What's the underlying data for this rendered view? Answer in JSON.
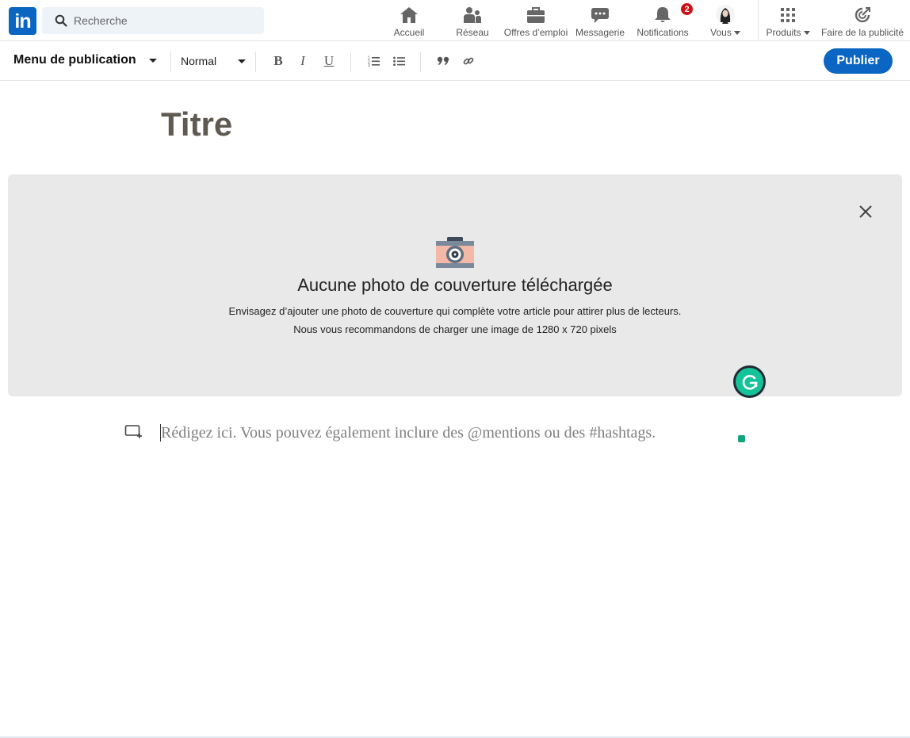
{
  "nav": {
    "logo": "in",
    "search_placeholder": "Recherche",
    "home": "Accueil",
    "network": "Réseau",
    "jobs": "Offres d’emploi",
    "messaging": "Messagerie",
    "notifications": "Notifications",
    "notifications_count": "2",
    "me": "Vous",
    "products": "Produits",
    "advertise": "Faire de la publicité"
  },
  "toolbar": {
    "publication_menu": "Menu de publication",
    "text_style": "Normal",
    "bold": "B",
    "italic": "I",
    "underline": "U",
    "publish": "Publier"
  },
  "article": {
    "title_placeholder": "Titre",
    "cover_heading": "Aucune photo de couverture téléchargée",
    "cover_line1": "Envisagez d’ajouter une photo de couverture qui complète votre article pour attirer plus de lecteurs.",
    "cover_line2": "Nous vous recommandons de charger une image de 1280 x 720 pixels",
    "body_placeholder": "Rédigez ici. Vous pouvez également inclure des @mentions ou des #hashtags."
  },
  "colors": {
    "brand": "#0a66c2",
    "notification_badge": "#cc1016",
    "grammarly": "#15c39a"
  }
}
